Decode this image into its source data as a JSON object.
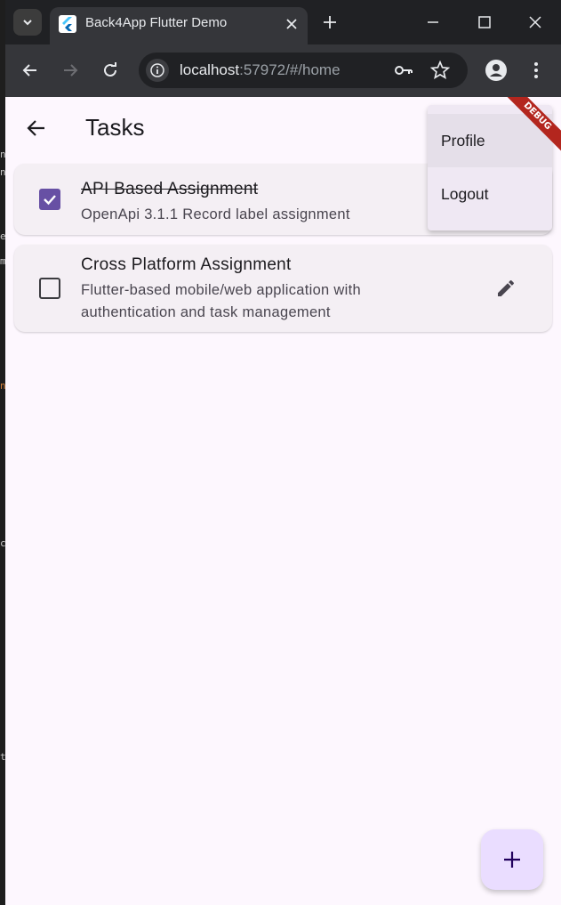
{
  "browser": {
    "tab_title": "Back4App Flutter Demo",
    "url_host": "localhost",
    "url_rest": ":57972/#/home"
  },
  "app": {
    "title": "Tasks",
    "tasks": [
      {
        "title": "API Based Assignment",
        "description": "OpenApi 3.1.1 Record label assignment",
        "done": true
      },
      {
        "title": "Cross Platform Assignment",
        "description_line1": "Flutter-based mobile/web application with",
        "description_line2": "authentication and task management",
        "done": false
      }
    ],
    "menu": {
      "items": [
        "Profile",
        "Logout"
      ]
    },
    "debug_label": "DEBUG"
  },
  "colors": {
    "accent": "#6750a4",
    "background": "#fdf7fe",
    "debug": "#b3261e",
    "fab": "#eaddff"
  }
}
